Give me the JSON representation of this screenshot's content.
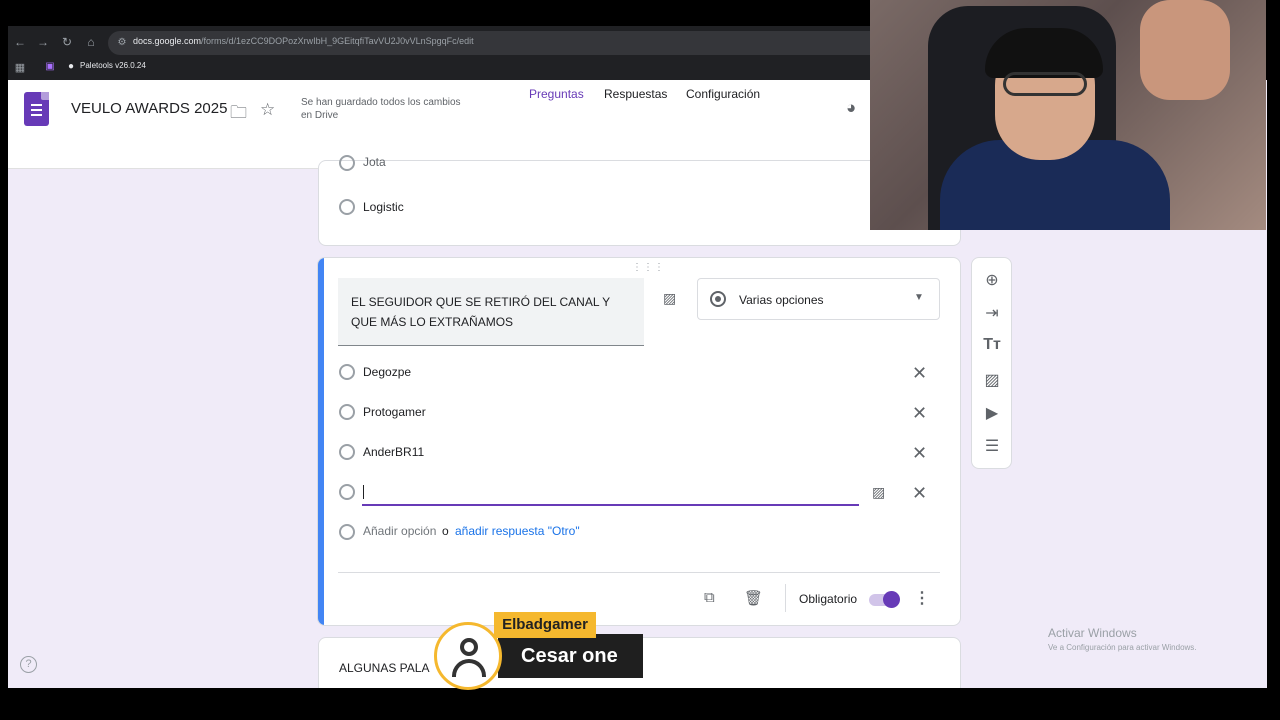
{
  "browser": {
    "url_host": "docs.google.com",
    "url_path": "/forms/d/1ezCC9DOPozXrwIbH_9GEitqfiTavVU2J0vVLnSpgqFc/edit",
    "bookmark": "Paletools v26.0.24"
  },
  "header": {
    "title": "VEULO AWARDS 2025",
    "saved_status": "Se han guardado todos los cambios en Drive",
    "tabs": [
      {
        "label": "Preguntas",
        "active": true
      },
      {
        "label": "Respuestas",
        "active": false
      },
      {
        "label": "Configuración",
        "active": false
      }
    ]
  },
  "previous_card": {
    "partial_option": "Jota",
    "option": "Logistic"
  },
  "active_question": {
    "text": "EL SEGUIDOR QUE SE RETIRÓ DEL CANAL Y QUE MÁS LO EXTRAÑAMOS",
    "type": "Varias opciones",
    "options": [
      "Degozpe",
      "Protogamer",
      "AnderBR11"
    ],
    "new_option_value": "",
    "add_option": "Añadir opción",
    "or": "o",
    "add_other": "añadir respuesta \"Otro\"",
    "required_label": "Obligatorio",
    "required": true
  },
  "next_card": {
    "title_partial": "ALGUNAS PALA"
  },
  "side_toolbar": [
    "add-question-icon",
    "import-questions-icon",
    "add-title-icon",
    "add-image-icon",
    "add-video-icon",
    "add-section-icon"
  ],
  "windows_watermark": {
    "line1": "Activar Windows",
    "line2": "Ve a Configuración para activar Windows."
  },
  "overlay": {
    "top_label": "Elbadgamer",
    "name": "Cesar one"
  },
  "colors": {
    "accent": "#673ab7",
    "focus_bar": "#4285f4",
    "link": "#1a73e8",
    "badge": "#f5b82e"
  }
}
